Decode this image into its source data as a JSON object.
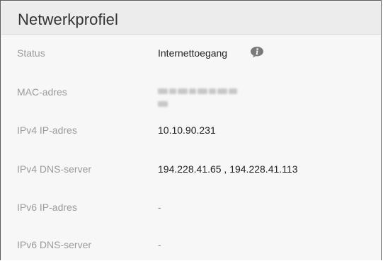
{
  "panel": {
    "title": "Netwerkprofiel"
  },
  "rows": [
    {
      "label": "Status",
      "value": "Internettoegang",
      "icon": "info-icon"
    },
    {
      "label": "MAC-adres",
      "value": ""
    },
    {
      "label": "IPv4 IP-adres",
      "value": "10.10.90.231"
    },
    {
      "label": "IPv4 DNS-server",
      "value": "194.228.41.65 , 194.228.41.113"
    },
    {
      "label": "IPv6 IP-adres",
      "value": "-"
    },
    {
      "label": "IPv6 DNS-server",
      "value": "-"
    }
  ],
  "colors": {
    "panel_bg": "#f7f7f7",
    "header_bg": "#ececec",
    "label": "#9b9b9b",
    "value": "#222222",
    "icon": "#7a7a7a"
  }
}
